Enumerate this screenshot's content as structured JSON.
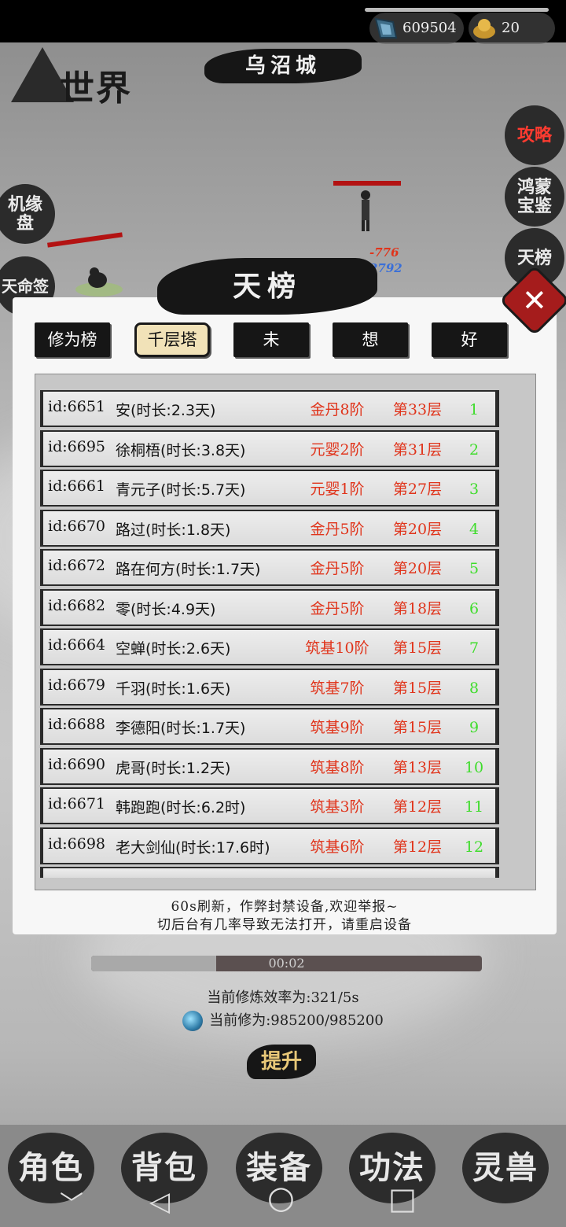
{
  "world_title": "世界",
  "location": "乌沼城",
  "currencies": {
    "crystal": "609504",
    "gold": "20"
  },
  "left_menu": [
    "机缘盘",
    "天命签"
  ],
  "right_menu": [
    "攻略",
    "鸿蒙宝鉴",
    "天榜"
  ],
  "battle": {
    "damage": "-776",
    "heal": "2792"
  },
  "modal": {
    "title": "天榜",
    "close_glyph": "✕",
    "tabs": [
      "修为榜",
      "千层塔",
      "未",
      "想",
      "好"
    ],
    "active_tab": "千层塔",
    "rows": [
      {
        "id": "id:6651",
        "name": "安(时长:2.3天)",
        "realm": "金丹8阶",
        "floor": "第33层",
        "rank": "1"
      },
      {
        "id": "id:6695",
        "name": "徐桐梧(时长:3.8天)",
        "realm": "元婴2阶",
        "floor": "第31层",
        "rank": "2"
      },
      {
        "id": "id:6661",
        "name": "青元子(时长:5.7天)",
        "realm": "元婴1阶",
        "floor": "第27层",
        "rank": "3"
      },
      {
        "id": "id:6670",
        "name": "路过(时长:1.8天)",
        "realm": "金丹5阶",
        "floor": "第20层",
        "rank": "4"
      },
      {
        "id": "id:6672",
        "name": "路在何方(时长:1.7天)",
        "realm": "金丹5阶",
        "floor": "第20层",
        "rank": "5"
      },
      {
        "id": "id:6682",
        "name": "零(时长:4.9天)",
        "realm": "金丹5阶",
        "floor": "第18层",
        "rank": "6"
      },
      {
        "id": "id:6664",
        "name": "空蝉(时长:2.6天)",
        "realm": "筑基10阶",
        "floor": "第15层",
        "rank": "7"
      },
      {
        "id": "id:6679",
        "name": "千羽(时长:1.6天)",
        "realm": "筑基7阶",
        "floor": "第15层",
        "rank": "8"
      },
      {
        "id": "id:6688",
        "name": "李德阳(时长:1.7天)",
        "realm": "筑基9阶",
        "floor": "第15层",
        "rank": "9"
      },
      {
        "id": "id:6690",
        "name": "虎哥(时长:1.2天)",
        "realm": "筑基8阶",
        "floor": "第13层",
        "rank": "10"
      },
      {
        "id": "id:6671",
        "name": "韩跑跑(时长:6.2时)",
        "realm": "筑基3阶",
        "floor": "第12层",
        "rank": "11"
      },
      {
        "id": "id:6698",
        "name": "老大剑仙(时长:17.6时)",
        "realm": "筑基6阶",
        "floor": "第12层",
        "rank": "12"
      }
    ],
    "notice_line1": "60s刷新，作弊封禁设备,欢迎举报~",
    "notice_line2": "切后台有几率导致无法打开，请重启设备"
  },
  "cultivation": {
    "timer": "00:02",
    "progress": 0.32,
    "efficiency": "当前修炼效率为:321/5s",
    "current": "当前修为:985200/985200",
    "upgrade_label": "提升"
  },
  "bottom_nav": [
    "角色",
    "背包",
    "装备",
    "功法",
    "灵兽"
  ],
  "system_nav": {
    "down": "﹀",
    "back": "◁",
    "home": "○",
    "recent": "□"
  },
  "colors": {
    "realm_red": "#e0341b",
    "rank_green": "#3fdc2c",
    "close_red": "#a51c1c",
    "active_tab": "#f1e2b8"
  }
}
